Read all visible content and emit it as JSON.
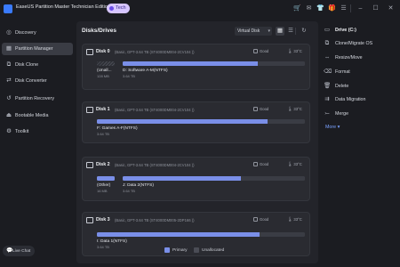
{
  "titlebar": {
    "title": "EaseUS Partition Master Technician Edition",
    "badge": "Tech",
    "icons": [
      "cart-icon",
      "message-icon",
      "shirt-icon",
      "gift-icon",
      "menu-icon",
      "minimize-icon",
      "maximize-icon",
      "close-icon"
    ]
  },
  "sidebar": {
    "items": [
      {
        "label": "Discovery",
        "icon": "compass-icon",
        "active": false
      },
      {
        "label": "Partition Manager",
        "icon": "partition-icon",
        "active": true
      },
      {
        "label": "Disk Clone",
        "icon": "clone-icon",
        "active": false
      },
      {
        "label": "Disk Converter",
        "icon": "convert-icon",
        "active": false
      },
      {
        "label": "Partition Recovery",
        "icon": "recovery-icon",
        "active": false
      },
      {
        "label": "Bootable Media",
        "icon": "usb-icon",
        "active": false
      },
      {
        "label": "Toolkit",
        "icon": "toolkit-icon",
        "active": false
      }
    ],
    "live_chat": "Live Chat"
  },
  "main": {
    "title": "Disks/Drives",
    "view_mode": "Virtual Disk",
    "disks": [
      {
        "name": "Disk 0",
        "info": "(Basic, GPT-3.64 TB (ST4000DM004-2CV104 ))",
        "health": "Good",
        "temp": "33°C",
        "partitions": [
          {
            "label": "(Unall...",
            "size": "128 MB",
            "type": "unallocated",
            "fill": 0
          },
          {
            "label": "D: Software A-M(NTFS)",
            "size": "3.64 TB",
            "type": "primary",
            "fill": 0.74
          }
        ]
      },
      {
        "name": "Disk 1",
        "info": "(Basic, GPT-3.64 TB (ST4000DM004-2CV104 ))",
        "health": "Good",
        "temp": "33°C",
        "partitions": [
          {
            "label": "F: Games A-F(NTFS)",
            "size": "3.64 TB",
            "type": "primary",
            "fill": 0.82
          }
        ]
      },
      {
        "name": "Disk 2",
        "info": "(Basic, GPT-3.64 TB (ST4000DM004-2CV104 ))",
        "health": "Good",
        "temp": "33°C",
        "partitions": [
          {
            "label": "(Other)",
            "size": "16 MB",
            "type": "primary",
            "fill": 1
          },
          {
            "label": "J: Data 2(NTFS)",
            "size": "3.64 TB",
            "type": "primary",
            "fill": 0.65
          }
        ]
      },
      {
        "name": "Disk 3",
        "info": "(Basic, GPT-3.64 TB (ST4000DM005-2DP166 ))",
        "health": "Good",
        "temp": "33°C",
        "partitions": [
          {
            "label": "I: Data 1(NTFS)",
            "size": "3.64 TB",
            "type": "primary",
            "fill": 0.78
          }
        ]
      }
    ],
    "legend": {
      "primary": "Primary",
      "unallocated": "Unallocated"
    },
    "colors": {
      "primary": "#7a8fe8",
      "unallocated": "#4a4c55",
      "accent": "#3a7bfd"
    }
  },
  "operations": {
    "header": "Drive (C:)",
    "items": [
      {
        "label": "Clone/Migrate OS",
        "icon": "clone-os-icon"
      },
      {
        "label": "Resize/Move",
        "icon": "resize-icon"
      },
      {
        "label": "Format",
        "icon": "format-icon"
      },
      {
        "label": "Delete",
        "icon": "delete-icon"
      },
      {
        "label": "Data Migration",
        "icon": "migration-icon"
      },
      {
        "label": "Merge",
        "icon": "merge-icon"
      }
    ],
    "more": "More"
  }
}
